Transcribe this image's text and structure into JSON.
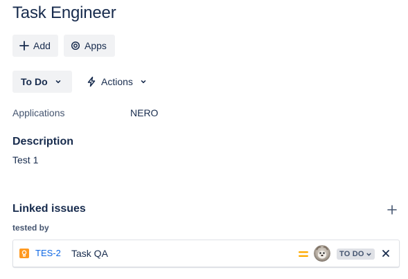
{
  "header": {
    "title": "Task Engineer"
  },
  "toolbar": {
    "add_label": "Add",
    "apps_label": "Apps",
    "status_label": "To Do",
    "actions_label": "Actions"
  },
  "fields": {
    "applications_label": "Applications",
    "applications_value": "NERO"
  },
  "description": {
    "heading": "Description",
    "text": "Test 1"
  },
  "linked_issues": {
    "heading": "Linked issues",
    "relation": "tested by",
    "items": [
      {
        "key": "TES-2",
        "summary": "Task QA",
        "status": "TO DO",
        "type_icon": "test-issue-icon",
        "priority_icon": "priority-medium-icon",
        "priority_color": "#ffab00"
      }
    ]
  },
  "colors": {
    "link": "#0c66e4",
    "button_bg": "#f1f2f4",
    "text": "#172b4d",
    "issue_type": "#ff991f"
  }
}
